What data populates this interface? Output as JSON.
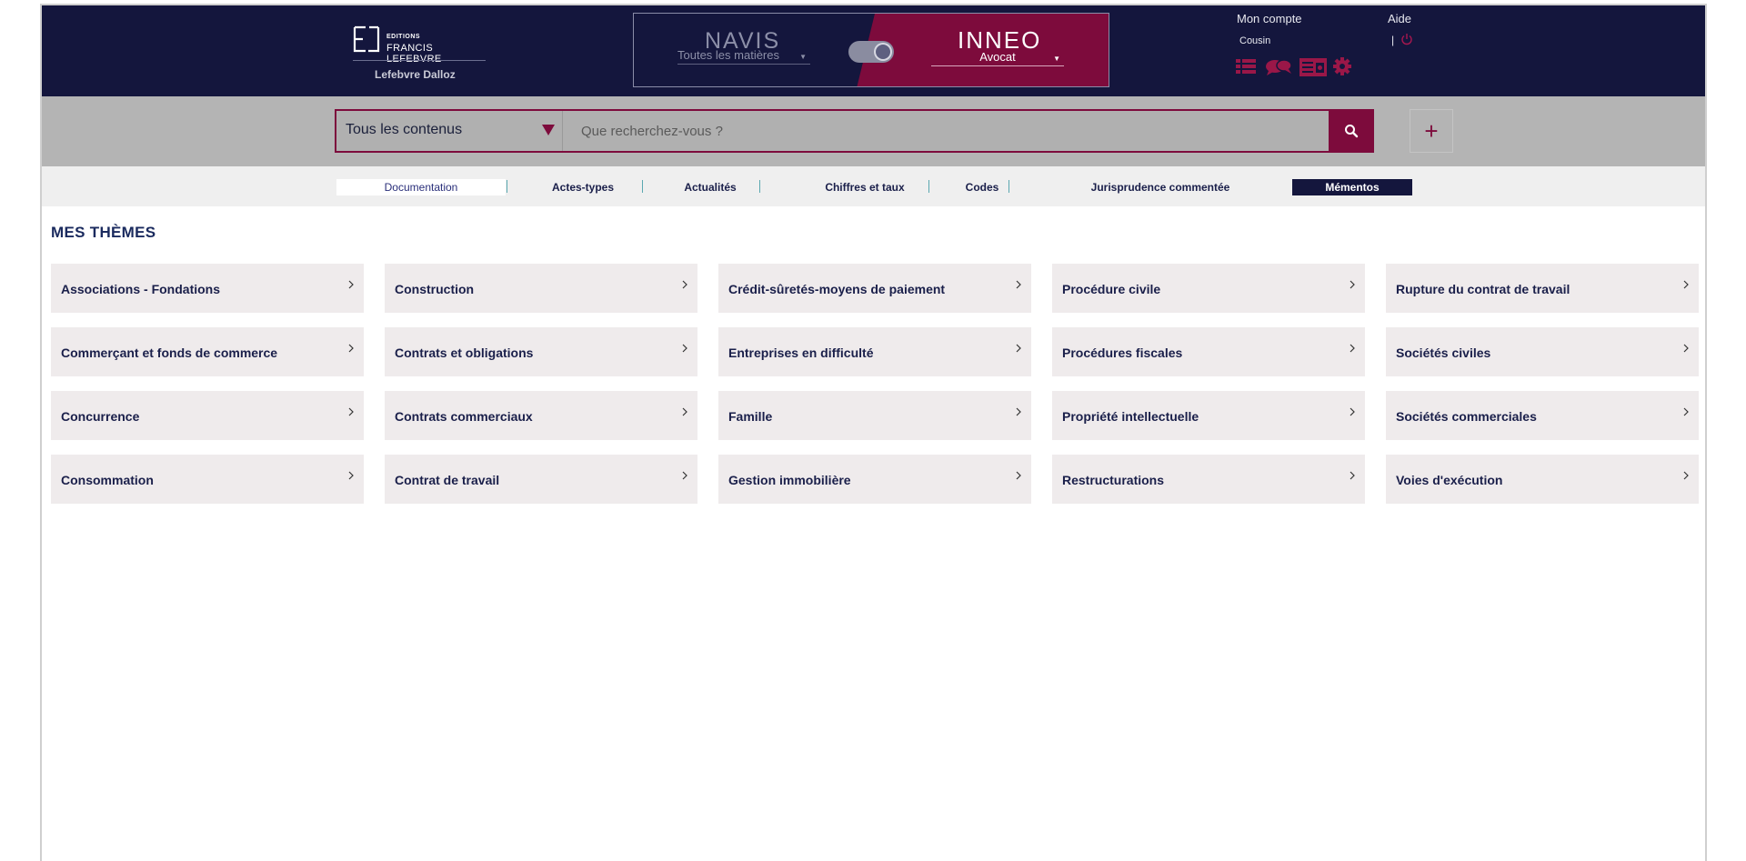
{
  "brand": {
    "editions": "EDITIONS",
    "name": "FRANCIS LEFEBVRE",
    "group": "Lefebvre Dalloz"
  },
  "switcher": {
    "left_title": "NAVIS",
    "left_sub": "Toutes les matières",
    "right_title": "INNEO",
    "right_sub": "Avocat"
  },
  "account": {
    "label": "Mon compte",
    "user": "Cousin",
    "help": "Aide",
    "separator": "|"
  },
  "tools": [
    "list-icon",
    "chat-bubbles-icon",
    "news-icon",
    "gear-icon"
  ],
  "search": {
    "scope": "Tous les contenus",
    "placeholder": "Que recherchez-vous ?",
    "add_label": "+"
  },
  "tabs": [
    {
      "label": "Documentation",
      "state": "active"
    },
    {
      "label": "Actes-types",
      "state": "normal"
    },
    {
      "label": "Actualités",
      "state": "normal"
    },
    {
      "label": "Chiffres et taux",
      "state": "normal"
    },
    {
      "label": "Codes",
      "state": "normal"
    },
    {
      "label": "Jurisprudence commentée",
      "state": "normal"
    },
    {
      "label": "Mémentos",
      "state": "highlight"
    }
  ],
  "themes": {
    "title": "MES THÈMES",
    "columns": [
      [
        "Associations - Fondations",
        "Commerçant et fonds de commerce",
        "Concurrence",
        "Consommation"
      ],
      [
        "Construction",
        "Contrats et obligations",
        "Contrats commerciaux",
        "Contrat de travail"
      ],
      [
        "Crédit-sûretés-moyens de paiement",
        "Entreprises en difficulté",
        "Famille",
        "Gestion immobilière"
      ],
      [
        "Procédure civile",
        "Procédures fiscales",
        "Propriété intellectuelle",
        "Restructurations"
      ],
      [
        "Rupture du contrat de travail",
        "Sociétés civiles",
        "Sociétés commerciales",
        "Voies d'exécution"
      ]
    ]
  },
  "colors": {
    "navy": "#14163d",
    "accent": "#7d0b3c",
    "card": "#efebec",
    "band": "#b4b4b4"
  }
}
